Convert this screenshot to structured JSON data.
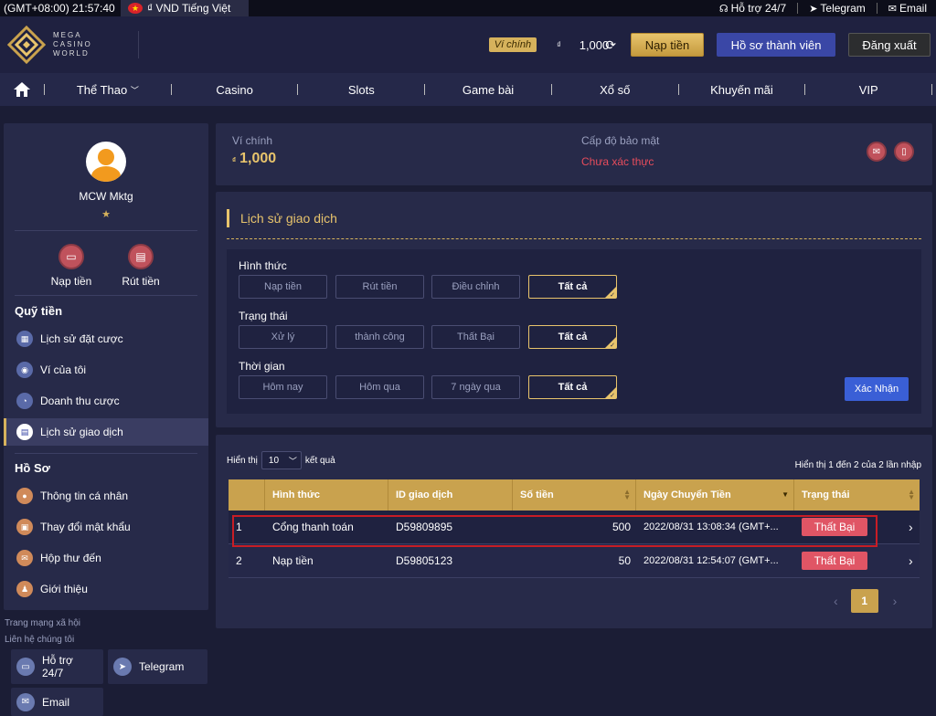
{
  "topbar": {
    "time": "(GMT+08:00) 21:57:40",
    "flag_star": "★",
    "lang": "₫ VND Tiếng Việt",
    "support": "Hỗ trợ 24/7",
    "telegram": "Telegram",
    "email": "Email"
  },
  "logo": {
    "line1": "MEGA",
    "line2": "CASINO",
    "line3": "WORLD"
  },
  "header": {
    "wallet_tag": "Ví chính",
    "currency": "₫",
    "balance": "1,000",
    "deposit": "Nạp tiền",
    "profile": "Hồ sơ thành viên",
    "logout": "Đăng xuất"
  },
  "nav": {
    "items": [
      "Thể Thao",
      "Casino",
      "Slots",
      "Game bài",
      "Xổ số",
      "Khuyến mãi",
      "VIP"
    ]
  },
  "sidebar": {
    "username": "MCW Mktg",
    "star": "★",
    "deposit": "Nạp tiền",
    "withdraw": "Rút tiền",
    "section1": "Quỹ tiền",
    "menu1": [
      "Lịch sử đặt cược",
      "Ví của tôi",
      "Doanh thu cược",
      "Lịch sử giao dịch"
    ],
    "section2": "Hồ Sơ",
    "menu2": [
      "Thông tin cá nhân",
      "Thay đổi mật khẩu",
      "Hộp thư đến",
      "Giới thiệu"
    ],
    "social_label": "Trang mạng xã hội",
    "contact_label": "Liên hệ chúng tôi",
    "support": "Hỗ trợ 24/7",
    "telegram": "Telegram",
    "email": "Email"
  },
  "wallet": {
    "label": "Ví chính",
    "currency": "₫",
    "amount": "1,000",
    "security_label": "Cấp độ bảo mật",
    "security_status": "Chưa xác thực"
  },
  "history": {
    "title": "Lịch sử giao dịch",
    "type_label": "Hình thức",
    "type_options": [
      "Nạp tiền",
      "Rút tiền",
      "Điều chỉnh",
      "Tất cả"
    ],
    "status_label": "Trạng thái",
    "status_options": [
      "Xử lý",
      "thành công",
      "Thất Bại",
      "Tất cả"
    ],
    "time_label": "Thời gian",
    "time_options": [
      "Hôm nay",
      "Hôm qua",
      "7 ngày qua",
      "Tất cả"
    ],
    "confirm": "Xác Nhận"
  },
  "table": {
    "show_prefix": "Hiển thị",
    "page_size": "10",
    "show_suffix": "kết quả",
    "summary": "Hiển thị 1 đến 2 của 2 lần nhập",
    "headers": [
      "",
      "Hình thức",
      "ID giao dịch",
      "Số tiền",
      "Ngày Chuyển Tiền",
      "Trạng thái"
    ],
    "rows": [
      {
        "no": "1",
        "type": "Cổng thanh toán",
        "id": "D59809895",
        "amount": "500",
        "date": "2022/08/31 13:08:34 (GMT+...",
        "status": "Thất Bại"
      },
      {
        "no": "2",
        "type": "Nạp tiền",
        "id": "D59805123",
        "amount": "50",
        "date": "2022/08/31 12:54:07 (GMT+...",
        "status": "Thất Bại"
      }
    ],
    "page": "1"
  }
}
